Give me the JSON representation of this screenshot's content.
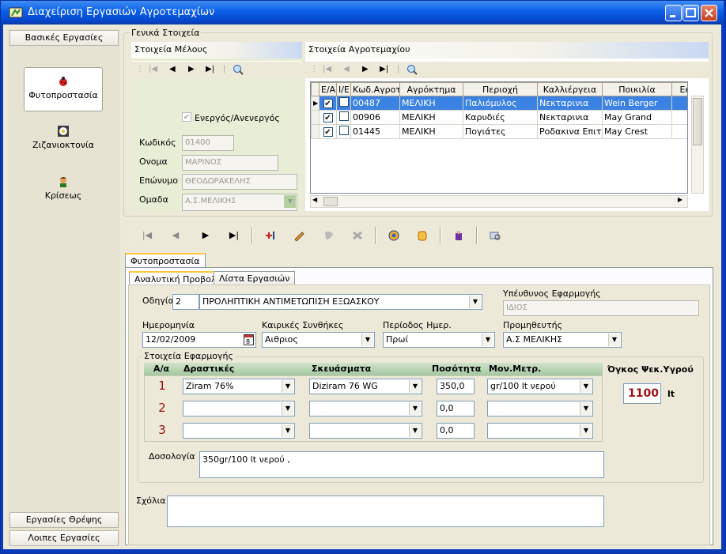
{
  "window": {
    "title": "Διαχείριση Εργασιών Αγροτεμαχίων"
  },
  "nav": {
    "top_header": "Βασικές Εργασίες",
    "items": [
      {
        "label": "Φυτοπροστασία",
        "icon": "ladybug-icon"
      },
      {
        "label": "Ζιζανιοκτονία",
        "icon": "flower-icon"
      },
      {
        "label": "Κρίσεως",
        "icon": "person-icon"
      }
    ],
    "bottom_headers": [
      "Εργασίες Θρέψης",
      "Λοιπες Εργασίες"
    ]
  },
  "general": {
    "legend": "Γενικά Στοιχεία",
    "member_title": "Στοιχεία Μέλους",
    "active_label": "Ενεργός/Ανενεργός",
    "code_label": "Κωδικός",
    "code_value": "01400",
    "name_label": "Ονομα",
    "name_value": "ΜΑΡΙΝΟΣ",
    "surname_label": "Επώνυμο",
    "surname_value": "ΘΕΟΔΩΡΑΚΕΛΗΣ",
    "group_label": "Ομαδα",
    "group_value": "Α.Σ.ΜΕΛΙΚΗΣ"
  },
  "plots": {
    "title": "Στοιχεία Αγροτεμαχίου",
    "columns": [
      "Ε/Α",
      "Ι/Ε",
      "Κωδ.Αγροτ.",
      "Αγρόκτημα",
      "Περιοχή",
      "Καλλιέργεια",
      "Ποικιλία",
      "Εκτ"
    ],
    "rows": [
      {
        "code": "00487",
        "farm": "ΜΕΛΙΚΗ",
        "area": "Παλιόμυλος",
        "crop": "Νεκταρινια",
        "variety": "Wein Berger",
        "ea": true,
        "ie": false
      },
      {
        "code": "00906",
        "farm": "ΜΕΛΙΚΗ",
        "area": "Καρυδιές",
        "crop": "Νεκταρινια",
        "variety": "May Grand",
        "ea": true,
        "ie": false
      },
      {
        "code": "01445",
        "farm": "ΜΕΛΙΚΗ",
        "area": "Πογιάτες",
        "crop": "Ροδακινα Επιτρ",
        "variety": "May Crest",
        "ea": true,
        "ie": false
      }
    ]
  },
  "tabs": {
    "outer": "Φυτοπροστασία",
    "inner": [
      "Αναλυτική Προβολή",
      "Λίστα Εργασιών"
    ]
  },
  "form": {
    "directive_label": "Οδηγία",
    "directive_num": "2",
    "directive_text": "ΠΡΟΛΗΠΤΙΚΗ ΑΝΤΙΜΕΤΩΠΙΣΗ ΕΞΩΑΣΚΟΥ",
    "responsible_label": "Υπέυθυνος Εφαρμογής",
    "responsible_value": "ΙΔΙΟΣ",
    "date_label": "Ημερομηνία",
    "date_value": "12/02/2009",
    "weather_label": "Καιρικές Συνθήκες",
    "weather_value": "Αιθριος",
    "period_label": "Περίοδος Ημερ.",
    "period_value": "Πρωί",
    "supplier_label": "Προμηθευτής",
    "supplier_value": "Α.Σ ΜΕΛΙΚΗΣ",
    "app_legend": "Στοιχεία Εφαρμογής",
    "app_columns": [
      "Α/α",
      "Δραστικές",
      "Σκευάσματα",
      "Ποσότητα",
      "Μον.Μετρ."
    ],
    "app_rows": [
      {
        "n": "1",
        "active": "Ziram 76%",
        "product": "Diziram 76 WG",
        "qty": "350,0",
        "unit": "gr/100 lt νερού"
      },
      {
        "n": "2",
        "active": "",
        "product": "",
        "qty": "0,0",
        "unit": ""
      },
      {
        "n": "3",
        "active": "",
        "product": "",
        "qty": "0,0",
        "unit": ""
      }
    ],
    "volume_label": "Όγκος Ψεκ.Υγρού",
    "volume_value": "1100",
    "volume_unit": "lt",
    "dosage_label": "Δοσολογία",
    "dosage_value": "350gr/100 lt νερού ,",
    "comments_label": "Σχόλια",
    "comments_value": ""
  },
  "colors": {
    "title_bar": "#0a5fe8",
    "selection": "#3b82e3",
    "header_green": "#a4c7a0",
    "number_red": "#a01010"
  }
}
